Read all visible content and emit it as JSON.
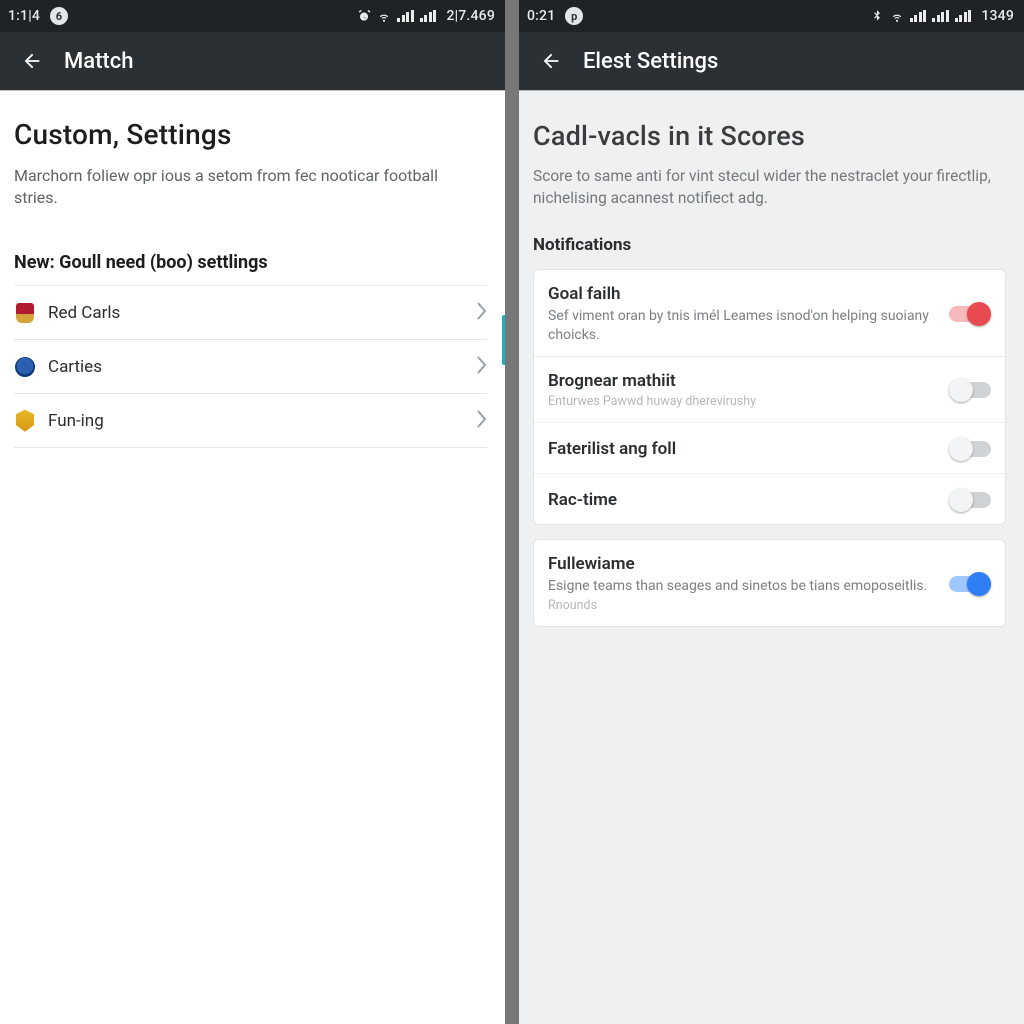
{
  "left": {
    "statusbar": {
      "time": "1:1|4",
      "badge": "6",
      "right_text": "2|7.469"
    },
    "appbar": {
      "title": "Mattch"
    },
    "page": {
      "heading": "Custom, Settings",
      "description": "Marchorn foliew opr ious a setom from fec nooticar football stries.",
      "section_label": "New: Goull need (boo) settlings",
      "items": [
        {
          "label": "Red Carls"
        },
        {
          "label": "Carties"
        },
        {
          "label": "Fun-ing"
        }
      ]
    }
  },
  "right": {
    "statusbar": {
      "time": "0:21",
      "badge": "p",
      "right_text": "1349"
    },
    "appbar": {
      "title": "Elest Settings"
    },
    "page": {
      "heading": "Cadl-vacls in it Scores",
      "description": "Score to same anti for vint stecul wider the nestraclet your firectlip, nichelising acannest notifiect adg.",
      "notifications_label": "Notifications",
      "group1": [
        {
          "title": "Goal failh",
          "sub": "Sef viment oran by tnis imél Leames isnod'on helping suoiany choicks.",
          "toggle": "on-red"
        },
        {
          "title": "Brognear mathiit",
          "sub": "Enturwes Pawwd huway dherevirushy",
          "sub_faint": true,
          "toggle": "off"
        },
        {
          "title": "Faterilist ang foll",
          "toggle": "off"
        },
        {
          "title": "Rac-time",
          "toggle": "off"
        }
      ],
      "group2": [
        {
          "title": "Fullewiame",
          "sub": "Esigne teams than seages and sinetos be tians emoposeitlis.",
          "sub2": "Rnounds",
          "toggle": "on"
        }
      ]
    }
  }
}
